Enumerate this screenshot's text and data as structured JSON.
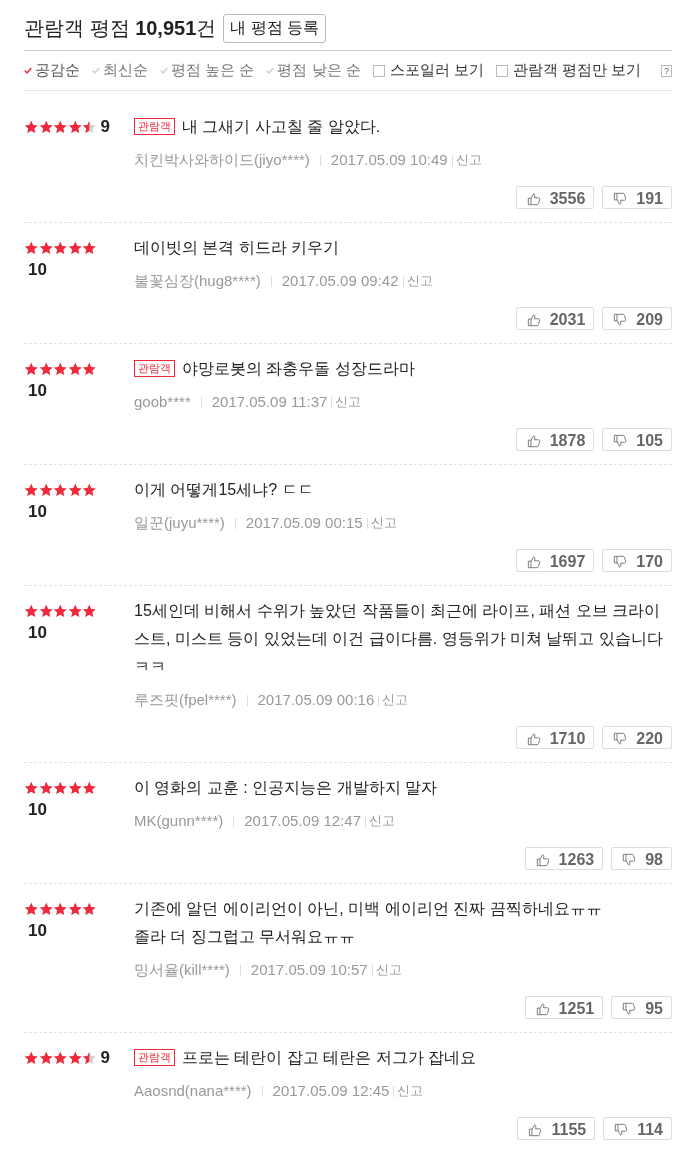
{
  "header": {
    "title": "관람객 평점 **10,951**건",
    "button": "내 평점 등록"
  },
  "sort_options": [
    {
      "label": "공감순",
      "selected": true
    },
    {
      "label": "최신순",
      "selected": false
    },
    {
      "label": "평점 높은 순",
      "selected": false
    },
    {
      "label": "평점 낮은 순",
      "selected": false
    }
  ],
  "filters": [
    {
      "label": "스포일러 보기",
      "checked": false
    },
    {
      "label": "관람객 평점만 보기",
      "checked": false
    }
  ],
  "help": "?",
  "reviews": [
    {
      "stars": 4.5,
      "score": "9",
      "badge": "관람객",
      "text": "내 그새기 사고칠 줄 알았다.",
      "author": "치킨박사와하이드(jiyo****)",
      "date": "2017.05.09 10:49",
      "report": "신고",
      "likes": "3556",
      "dislikes": "191"
    },
    {
      "stars": 5,
      "score": "10",
      "text": "데이빗의 본격 히드라 키우기",
      "author": "불꽃심장(hug8****)",
      "date": "2017.05.09 09:42",
      "report": "신고",
      "likes": "2031",
      "dislikes": "209"
    },
    {
      "stars": 5,
      "score": "10",
      "badge": "관람객",
      "text": "야망로봇의 좌충우돌 성장드라마",
      "author": "goob****",
      "date": "2017.05.09 11:37",
      "report": "신고",
      "likes": "1878",
      "dislikes": "105"
    },
    {
      "stars": 5,
      "score": "10",
      "text": "이게 어떻게15세냐? ㄷㄷ",
      "author": "일꾼(juyu****)",
      "date": "2017.05.09 00:15",
      "report": "신고",
      "likes": "1697",
      "dislikes": "170"
    },
    {
      "stars": 5,
      "score": "10",
      "text": "15세인데 비해서 수위가 높았던 작품들이 최근에 라이프, 패션 오브 크라이스트, 미스트 등이 있었는데 이건 급이다름. 영등위가 미쳐 날뛰고 있습니다 ㅋㅋ",
      "author": "루즈핏(fpel****)",
      "date": "2017.05.09 00:16",
      "report": "신고",
      "likes": "1710",
      "dislikes": "220"
    },
    {
      "stars": 5,
      "score": "10",
      "text": "이 영화의 교훈 : 인공지능은 개발하지 말자",
      "author": "MK(gunn****)",
      "date": "2017.05.09 12:47",
      "report": "신고",
      "likes": "1263",
      "dislikes": "98"
    },
    {
      "stars": 5,
      "score": "10",
      "text": "기존에 알던 에이리언이 아닌, 미백 에이리언 진짜 끔찍하네요ㅠㅠ\n졸라 더 징그럽고 무서워요ㅠㅠ",
      "author": "밍서율(kill****)",
      "date": "2017.05.09 10:57",
      "report": "신고",
      "likes": "1251",
      "dislikes": "95"
    },
    {
      "stars": 4.5,
      "score": "9",
      "badge": "관람객",
      "text": "프로는 테란이 잡고 테란은 저그가 잡네요",
      "author": "Aaosnd(nana****)",
      "date": "2017.05.09 12:45",
      "report": "신고",
      "likes": "1155",
      "dislikes": "114"
    }
  ]
}
